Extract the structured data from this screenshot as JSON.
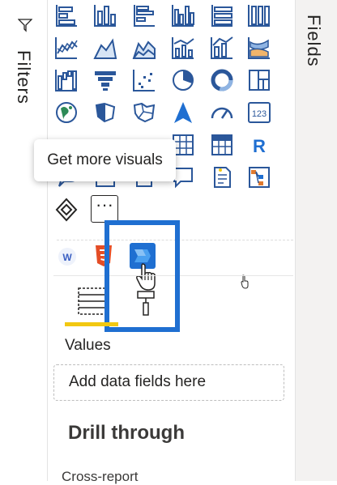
{
  "left_panel": {
    "filters_label": "Filters"
  },
  "right_panel": {
    "fields_label": "Fields"
  },
  "visualizations": {
    "icons": [
      "stacked-bar-chart-icon",
      "stacked-column-chart-icon",
      "clustered-bar-chart-icon",
      "clustered-column-chart-icon",
      "100-stacked-bar-chart-icon",
      "100-stacked-column-chart-icon",
      "line-chart-icon",
      "area-chart-icon",
      "stacked-area-chart-icon",
      "line-and-column-chart-icon",
      "line-and-stacked-column-chart-icon",
      "ribbon-chart-icon",
      "waterfall-chart-icon",
      "funnel-icon",
      "scatter-chart-icon",
      "pie-chart-icon",
      "donut-chart-icon",
      "treemap-icon",
      "map-icon",
      "filled-map-icon",
      "shape-map-icon",
      "azure-map-icon",
      "gauge-icon",
      "card-icon",
      "table-icon",
      "matrix-icon",
      "r-script-visual-icon",
      "qa-icon",
      "smart-narrative-icon",
      "decomposition-tree-icon",
      "power-apps-icon",
      "more-visuals-icon",
      "word-cloud-icon",
      "html-content-icon",
      "power-automate-icon"
    ],
    "card_label": "123",
    "r_label": "R",
    "more_button_label": "···",
    "tooltip_text": "Get more visuals",
    "custom_icon_w": "W"
  },
  "build": {
    "values_label": "Values",
    "add_data_placeholder": "Add data fields here"
  },
  "drill_through": {
    "title": "Drill through",
    "cross_report_label": "Cross-report"
  },
  "colors": {
    "accent": "#1f6fd1",
    "icon_blue": "#2b579a",
    "yellow": "#f2c811",
    "text": "#252423"
  }
}
